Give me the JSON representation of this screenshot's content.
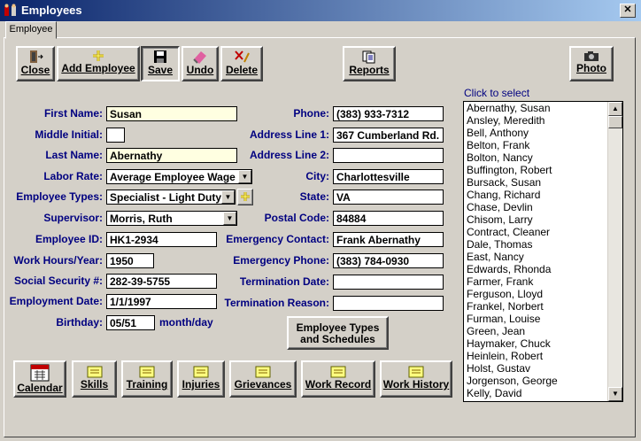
{
  "window": {
    "title": "Employees",
    "close_glyph": "✕"
  },
  "tabs": [
    {
      "label": "Employee"
    }
  ],
  "toolbar": {
    "close": "Close",
    "add_employee": "Add Employee",
    "save": "Save",
    "undo": "Undo",
    "delete": "Delete",
    "reports": "Reports",
    "photo": "Photo"
  },
  "form_left": {
    "first_name": {
      "label": "First Name:",
      "value": "Susan"
    },
    "middle_initial": {
      "label": "Middle Initial:",
      "value": ""
    },
    "last_name": {
      "label": "Last Name:",
      "value": "Abernathy"
    },
    "labor_rate": {
      "label": "Labor Rate:",
      "value": "Average Employee Wage"
    },
    "employee_types": {
      "label": "Employee Types:",
      "value": "Specialist - Light Duty"
    },
    "supervisor": {
      "label": "Supervisor:",
      "value": "Morris, Ruth"
    },
    "employee_id": {
      "label": "Employee ID:",
      "value": "HK1-2934"
    },
    "work_hours": {
      "label": "Work Hours/Year:",
      "value": "1950"
    },
    "ssn": {
      "label": "Social Security #:",
      "value": "282-39-5755"
    },
    "employment_date": {
      "label": "Employment Date:",
      "value": "1/1/1997"
    },
    "birthday": {
      "label": "Birthday:",
      "value": "05/51",
      "suffix": "month/day"
    }
  },
  "form_right": {
    "phone": {
      "label": "Phone:",
      "value": "(383) 933-7312"
    },
    "address1": {
      "label": "Address Line 1:",
      "value": "367 Cumberland Rd."
    },
    "address2": {
      "label": "Address Line 2:",
      "value": ""
    },
    "city": {
      "label": "City:",
      "value": "Charlottesville"
    },
    "state": {
      "label": "State:",
      "value": "VA"
    },
    "postal_code": {
      "label": "Postal Code:",
      "value": "84884"
    },
    "emergency_contact": {
      "label": "Emergency Contact:",
      "value": "Frank Abernathy"
    },
    "emergency_phone": {
      "label": "Emergency Phone:",
      "value": "(383) 784-0930"
    },
    "termination_date": {
      "label": "Termination Date:",
      "value": ""
    },
    "termination_reason": {
      "label": "Termination Reason:",
      "value": ""
    }
  },
  "types_schedules_button": {
    "line1": "Employee Types",
    "line2": "and Schedules"
  },
  "bottom_buttons": {
    "calendar": "Calendar",
    "skills": "Skills",
    "training": "Training",
    "injuries": "Injuries",
    "grievances": "Grievances",
    "work_record": "Work Record",
    "work_history": "Work History"
  },
  "employee_list": {
    "hint": "Click to select",
    "items": [
      "Abernathy, Susan",
      "Ansley, Meredith",
      "Bell, Anthony",
      "Belton, Frank",
      "Bolton, Nancy",
      "Buffington, Robert",
      "Bursack, Susan",
      "Chang, Richard",
      "Chase, Devlin",
      "Chisom, Larry",
      "Contract, Cleaner",
      "Dale, Thomas",
      "East, Nancy",
      "Edwards, Rhonda",
      "Farmer, Frank",
      "Ferguson, Lloyd",
      "Frankel, Norbert",
      "Furman, Louise",
      "Green, Jean",
      "Haymaker, Chuck",
      "Heinlein, Robert",
      "Holst, Gustav",
      "Jorgenson, George",
      "Kelly, David"
    ]
  },
  "colors": {
    "label_blue": "#000080",
    "field_yellow": "#ffffe1",
    "face": "#d4d0c8"
  }
}
